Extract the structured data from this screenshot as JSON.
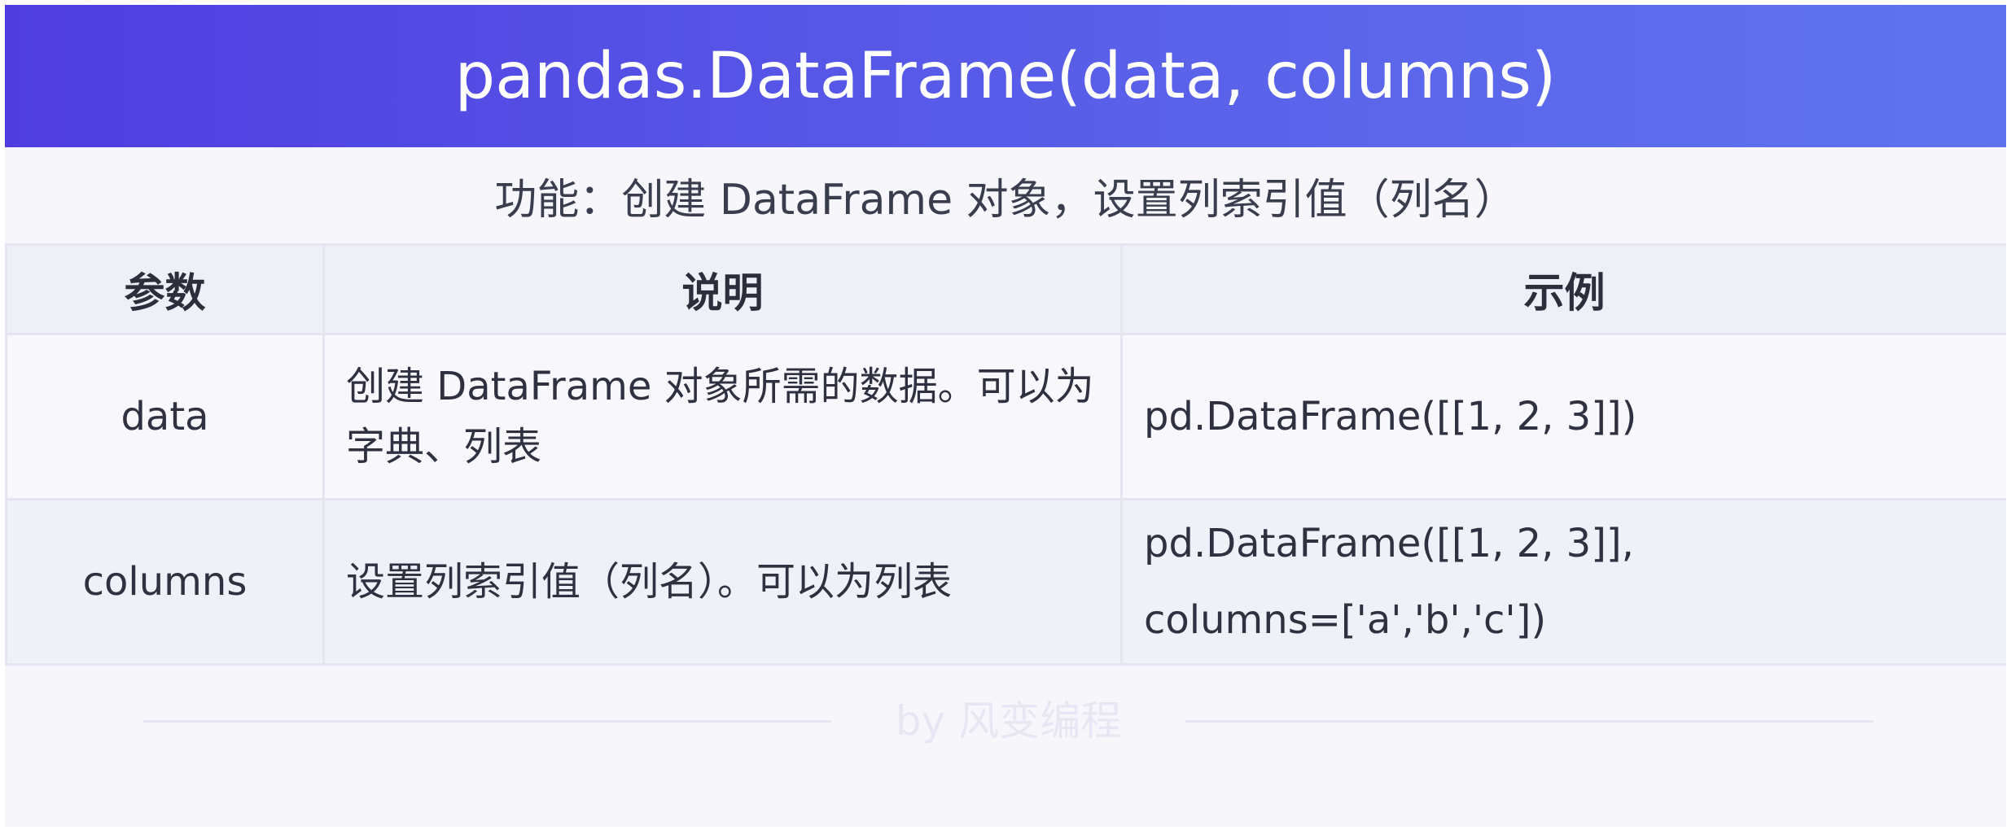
{
  "header": {
    "title": "pandas.DataFrame(data, columns)"
  },
  "subtitle": "功能：创建 DataFrame 对象，设置列索引值（列名）",
  "table": {
    "columns": [
      "参数",
      "说明",
      "示例"
    ],
    "rows": [
      {
        "param": "data",
        "description": "创建 DataFrame 对象所需的数据。可以为字典、列表",
        "example": "pd.DataFrame([[1, 2, 3]])"
      },
      {
        "param": "columns",
        "description": "设置列索引值（列名）。可以为列表",
        "example_line1": "pd.DataFrame([[1, 2, 3]],",
        "example_line2": "columns=['a','b','c'])"
      }
    ]
  },
  "footer": {
    "credit": "by 风变编程"
  },
  "colors": {
    "header_gradient_start": "#4f3de0",
    "header_gradient_end": "#5f73ee",
    "background": "#f6f6fb",
    "table_header_bg": "#efeff8"
  }
}
